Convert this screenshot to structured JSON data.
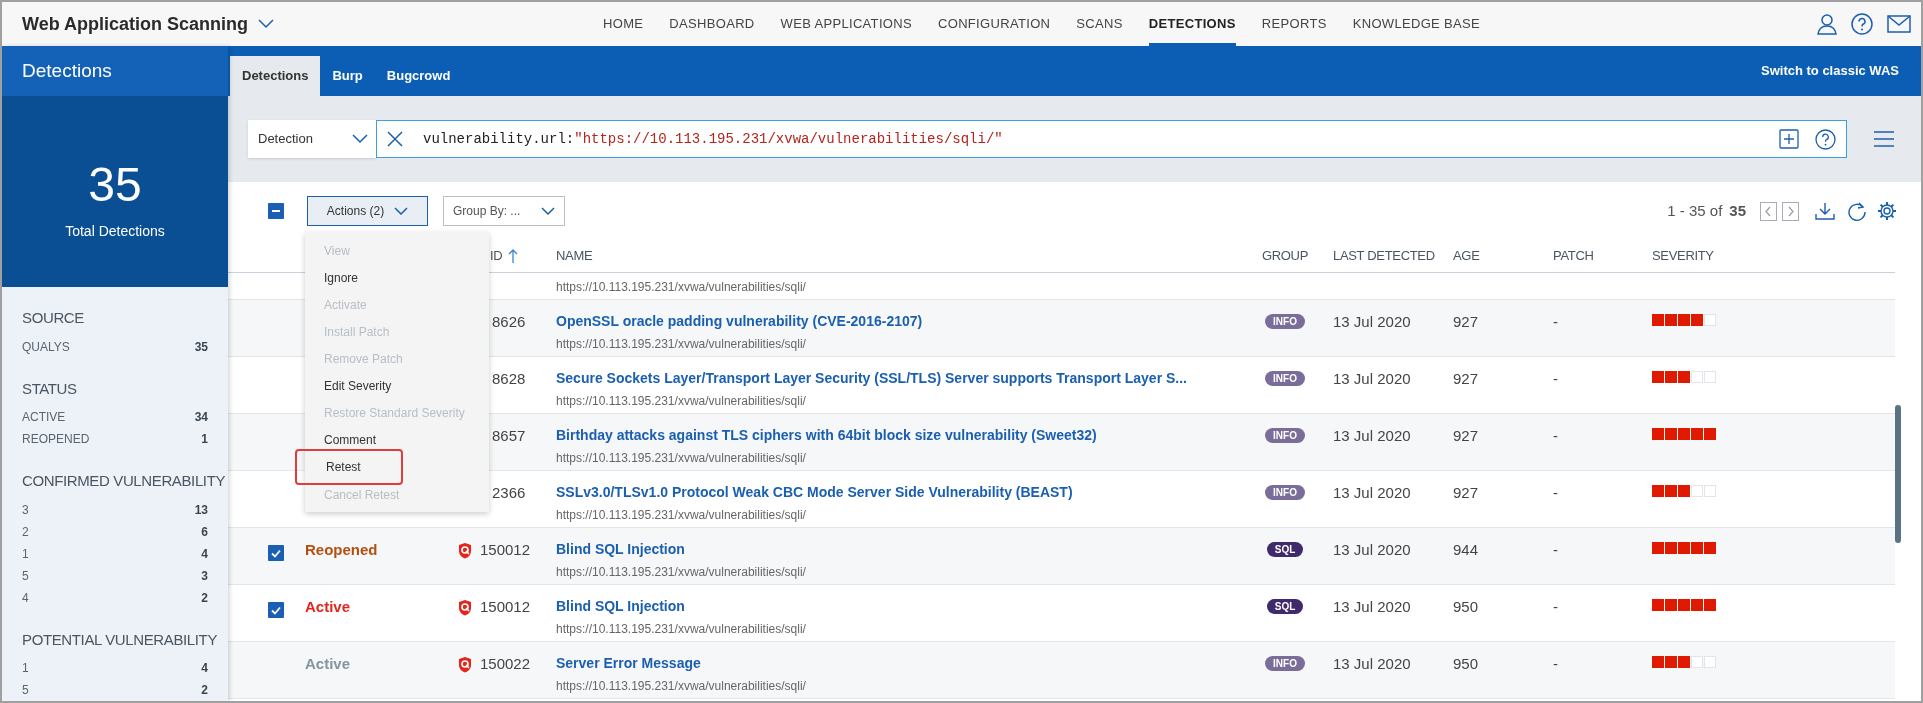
{
  "app": {
    "title": "Web Application Scanning"
  },
  "nav": [
    {
      "label": "HOME",
      "selected": false
    },
    {
      "label": "DASHBOARD",
      "selected": false
    },
    {
      "label": "WEB APPLICATIONS",
      "selected": false
    },
    {
      "label": "CONFIGURATION",
      "selected": false
    },
    {
      "label": "SCANS",
      "selected": false
    },
    {
      "label": "DETECTIONS",
      "selected": true
    },
    {
      "label": "REPORTS",
      "selected": false
    },
    {
      "label": "KNOWLEDGE BASE",
      "selected": false
    }
  ],
  "sidebar": {
    "title": "Detections",
    "total": "35",
    "total_label": "Total Detections",
    "sections": [
      {
        "heading": "SOURCE",
        "items": [
          {
            "label": "QUALYS",
            "count": "35"
          }
        ]
      },
      {
        "heading": "STATUS",
        "items": [
          {
            "label": "ACTIVE",
            "count": "34"
          },
          {
            "label": "REOPENED",
            "count": "1"
          }
        ]
      },
      {
        "heading": "CONFIRMED VULNERABILITY",
        "items": [
          {
            "label": "3",
            "count": "13"
          },
          {
            "label": "2",
            "count": "6"
          },
          {
            "label": "1",
            "count": "4"
          },
          {
            "label": "5",
            "count": "3"
          },
          {
            "label": "4",
            "count": "2"
          }
        ]
      },
      {
        "heading": "POTENTIAL VULNERABILITY",
        "items": [
          {
            "label": "1",
            "count": "4"
          },
          {
            "label": "5",
            "count": "2"
          }
        ]
      }
    ]
  },
  "tabs": [
    {
      "label": "Detections",
      "selected": true
    },
    {
      "label": "Burp",
      "selected": false
    },
    {
      "label": "Bugcrowd",
      "selected": false
    }
  ],
  "switch_link": "Switch to classic WAS",
  "search": {
    "field": "Detection",
    "query_key": "vulnerability.url:",
    "query_value": "\"https://10.113.195.231/xvwa/vulnerabilities/sqli/\""
  },
  "toolbar": {
    "select_all": {
      "partial": true
    },
    "actions": "Actions (2)",
    "group_by": "Group By: ...",
    "range": "1 - 35 of",
    "total": "35"
  },
  "actions_menu": [
    {
      "label": "View",
      "disabled": true,
      "highlighted": false
    },
    {
      "label": "Ignore",
      "disabled": false,
      "highlighted": false
    },
    {
      "label": "Activate",
      "disabled": true,
      "highlighted": false
    },
    {
      "label": "Install Patch",
      "disabled": true,
      "highlighted": false
    },
    {
      "label": "Remove Patch",
      "disabled": true,
      "highlighted": false
    },
    {
      "label": "Edit Severity",
      "disabled": false,
      "highlighted": false
    },
    {
      "label": "Restore Standard Severity",
      "disabled": true,
      "highlighted": false
    },
    {
      "label": "Comment",
      "disabled": false,
      "highlighted": false
    },
    {
      "label": "Retest",
      "disabled": false,
      "highlighted": true
    },
    {
      "label": "Cancel Retest",
      "disabled": true,
      "highlighted": false
    }
  ],
  "table": {
    "columns": [
      {
        "label": "ID",
        "sorted": true
      },
      {
        "label": "NAME",
        "sorted": false
      },
      {
        "label": "GROUP",
        "sorted": false
      },
      {
        "label": "LAST DETECTED",
        "sorted": false
      },
      {
        "label": "AGE",
        "sorted": false
      },
      {
        "label": "PATCH",
        "sorted": false
      },
      {
        "label": "SEVERITY",
        "sorted": false
      }
    ],
    "rows": [
      {
        "checked": false,
        "url": "https://10.113.195.231/xvwa/vulnerabilities/sqli/"
      },
      {
        "checked": false,
        "qid": "8626",
        "name": "OpenSSL oracle padding vulnerability (CVE-2016-2107)",
        "url": "https://10.113.195.231/xvwa/vulnerabilities/sqli/",
        "group": {
          "label": "INFO",
          "color": "#7b6d99"
        },
        "last_detected": "13 Jul 2020",
        "age": "927",
        "patch": "-",
        "stars": 4
      },
      {
        "checked": false,
        "qid": "8628",
        "name": "Secure Sockets Layer/Transport Layer Security (SSL/TLS) Server supports Transport Layer S...",
        "url": "https://10.113.195.231/xvwa/vulnerabilities/sqli/",
        "group": {
          "label": "INFO",
          "color": "#7b6d99"
        },
        "last_detected": "13 Jul 2020",
        "age": "927",
        "patch": "-",
        "stars": 3
      },
      {
        "checked": false,
        "qid": "8657",
        "name": "Birthday attacks against TLS ciphers with 64bit block size vulnerability (Sweet32)",
        "url": "https://10.113.195.231/xvwa/vulnerabilities/sqli/",
        "group": {
          "label": "INFO",
          "color": "#7b6d99"
        },
        "last_detected": "13 Jul 2020",
        "age": "927",
        "patch": "-",
        "stars": 5
      },
      {
        "checked": false,
        "qid": "2366",
        "name": "SSLv3.0/TLSv1.0 Protocol Weak CBC Mode Server Side Vulnerability (BEAST)",
        "url": "https://10.113.195.231/xvwa/vulnerabilities/sqli/",
        "group": {
          "label": "INFO",
          "color": "#7b6d99"
        },
        "last_detected": "13 Jul 2020",
        "age": "927",
        "patch": "-",
        "stars": 3
      },
      {
        "checked": true,
        "status": {
          "label": "Reopened",
          "color": "#b4500f"
        },
        "qid": "150012",
        "name": "Blind SQL Injection",
        "url": "https://10.113.195.231/xvwa/vulnerabilities/sqli/",
        "group": {
          "label": "SQL",
          "color": "#3f2a6b"
        },
        "last_detected": "13 Jul 2020",
        "age": "944",
        "patch": "-",
        "stars": 5
      },
      {
        "checked": true,
        "status": {
          "label": "Active",
          "color": "#e3261d"
        },
        "qid": "150012",
        "name": "Blind SQL Injection",
        "url": "https://10.113.195.231/xvwa/vulnerabilities/sqli/",
        "group": {
          "label": "SQL",
          "color": "#3f2a6b"
        },
        "last_detected": "13 Jul 2020",
        "age": "950",
        "patch": "-",
        "stars": 5
      },
      {
        "checked": false,
        "status": {
          "label": "Active",
          "color": "#8594a0"
        },
        "qid": "150022",
        "name": "Server Error Message",
        "url": "https://10.113.195.231/xvwa/vulnerabilities/sqli/",
        "group": {
          "label": "INFO",
          "color": "#7b6d99"
        },
        "last_detected": "13 Jul 2020",
        "age": "950",
        "patch": "-",
        "stars": 3
      }
    ]
  }
}
